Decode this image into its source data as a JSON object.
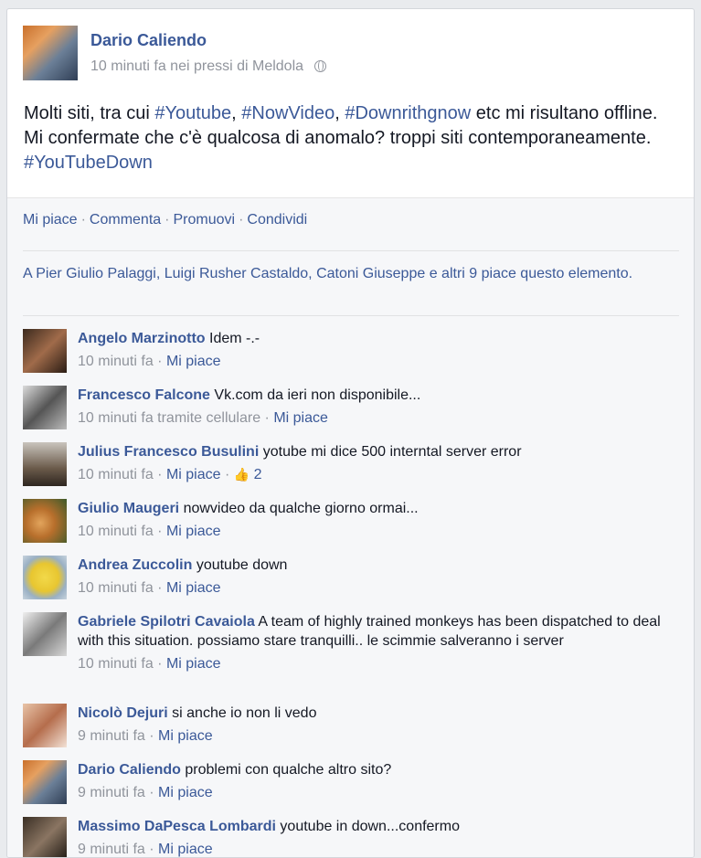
{
  "post": {
    "author": "Dario Caliendo",
    "time": "10 minuti fa",
    "location_prefix": "nei pressi di",
    "location": "Meldola",
    "privacy_icon": "globe-icon",
    "text": {
      "part1": "Molti siti, tra cui ",
      "tag1": "#Youtube",
      "sep1": ", ",
      "tag2": "#NowVideo",
      "sep2": ", ",
      "tag3": "#Downrithgnow",
      "part2": " etc mi risultano offline. Mi confermate che c'è qualcosa di anomalo? troppi siti contemporaneamente. ",
      "tag4": "#YouTubeDown"
    }
  },
  "actions": [
    "Mi piace",
    "Commenta",
    "Promuovi",
    "Condividi"
  ],
  "likes_summary": "A Pier Giulio Palaggi, Luigi Rusher Castaldo, Catoni Giuseppe e altri 9 piace questo elemento.",
  "comments": [
    {
      "name": "Angelo Marzinotto",
      "text": "Idem -.-",
      "time": "10 minuti fa",
      "like": "Mi piace"
    },
    {
      "name": "Francesco Falcone",
      "text": "Vk.com da ieri non disponibile...",
      "time": "10 minuti fa tramite cellulare",
      "like": "Mi piace"
    },
    {
      "name": "Julius Francesco Busulini",
      "text": "yotube mi dice 500 interntal server error",
      "time": "10 minuti fa",
      "like": "Mi piace",
      "like_count": "2"
    },
    {
      "name": "Giulio Maugeri",
      "text": "nowvideo da qualche giorno ormai...",
      "time": "10 minuti fa",
      "like": "Mi piace"
    },
    {
      "name": "Andrea Zuccolin",
      "text": "youtube down",
      "time": "10 minuti fa",
      "like": "Mi piace"
    },
    {
      "name": "Gabriele Spilotri Cavaiola",
      "text": "A team of highly trained monkeys has been dispatched to deal with this situation. possiamo stare tranquilli.. le scimmie salveranno i server",
      "time": "10 minuti fa",
      "like": "Mi piace"
    },
    {
      "name": "Nicolò Dejuri",
      "text": "si anche io non li vedo",
      "time": "9 minuti fa",
      "like": "Mi piace"
    },
    {
      "name": "Dario Caliendo",
      "text": "problemi con qualche altro sito?",
      "time": "9 minuti fa",
      "like": "Mi piace"
    },
    {
      "name": "Massimo DaPesca Lombardi",
      "text": "youtube in down...confermo",
      "time": "9 minuti fa",
      "like": "Mi piace"
    }
  ],
  "colors": {
    "link": "#3b5998",
    "meta": "#90949c",
    "text": "#141823",
    "feedback_bg": "#f6f7f9",
    "page_bg": "#e9ebee"
  }
}
